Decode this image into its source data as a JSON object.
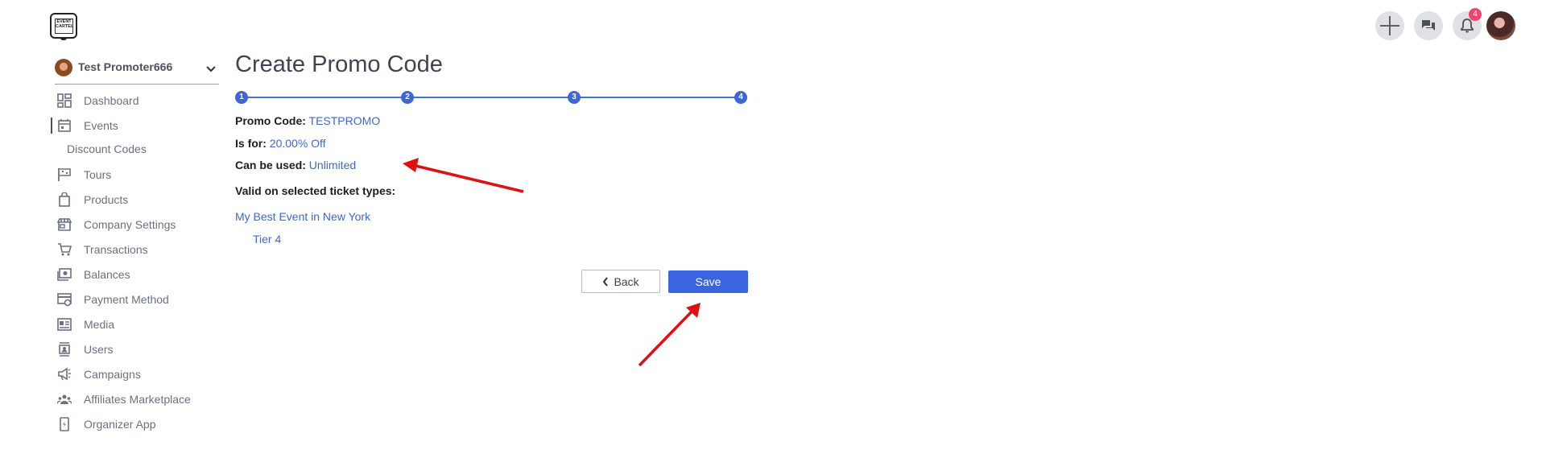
{
  "logo": {
    "text": "EVENT CARTEL"
  },
  "topbar": {
    "notification_count": "4",
    "icons": [
      "plus-icon",
      "chat-icon",
      "bell-icon",
      "avatar"
    ]
  },
  "sidebar": {
    "org_name": "Test Promoter666",
    "items": [
      {
        "label": "Dashboard",
        "icon": "dashboard-icon"
      },
      {
        "label": "Events",
        "icon": "calendar-icon"
      },
      {
        "label": "Discount Codes",
        "icon": ""
      },
      {
        "label": "Tours",
        "icon": "flag-icon"
      },
      {
        "label": "Products",
        "icon": "bag-icon"
      },
      {
        "label": "Company Settings",
        "icon": "store-icon"
      },
      {
        "label": "Transactions",
        "icon": "cart-icon"
      },
      {
        "label": "Balances",
        "icon": "money-icon"
      },
      {
        "label": "Payment Method",
        "icon": "card-gear-icon"
      },
      {
        "label": "Media",
        "icon": "media-icon"
      },
      {
        "label": "Users",
        "icon": "users-icon"
      },
      {
        "label": "Campaigns",
        "icon": "megaphone-icon"
      },
      {
        "label": "Affiliates Marketplace",
        "icon": "group-icon"
      },
      {
        "label": "Organizer App",
        "icon": "phone-icon"
      }
    ]
  },
  "main": {
    "title": "Create Promo Code",
    "steps": [
      "1",
      "2",
      "3",
      "4"
    ],
    "promo_code_label": "Promo Code:",
    "promo_code_value": "TESTPROMO",
    "is_for_label": "Is for:",
    "is_for_value": "20.00% Off",
    "can_be_used_label": "Can be used:",
    "can_be_used_value": "Unlimited",
    "valid_label": "Valid on selected ticket types:",
    "event_name": "My Best Event in New York",
    "ticket_tier": "Tier 4",
    "back_label": "Back",
    "save_label": "Save"
  },
  "colors": {
    "accent": "#3d66d6",
    "annotation_arrow": "#e01010",
    "badge": "#f0436c"
  }
}
